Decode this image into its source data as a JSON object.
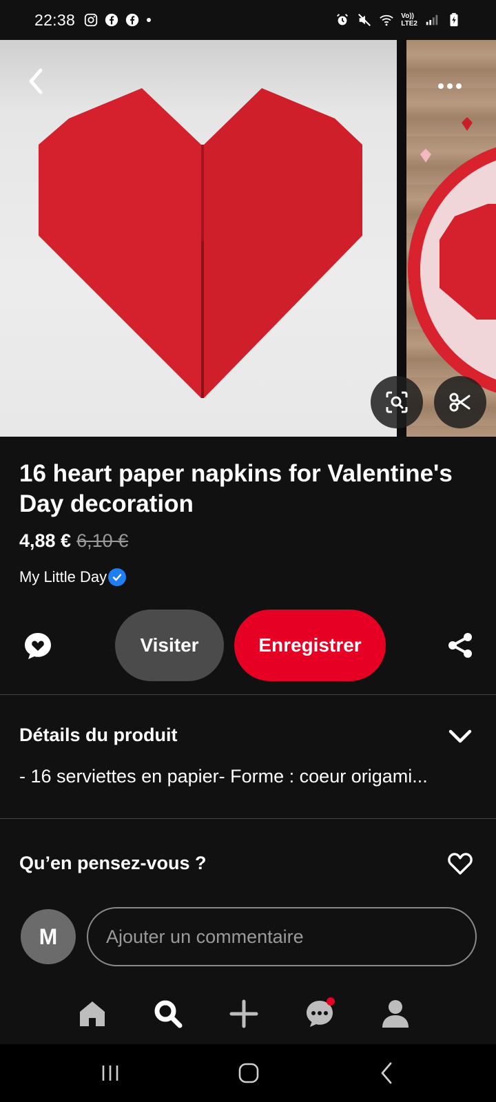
{
  "status_bar": {
    "time": "22:38",
    "left_icons": [
      "instagram-icon",
      "facebook-icon",
      "facebook-icon",
      "dot-icon"
    ],
    "right_icons": [
      "alarm-icon",
      "mute-icon",
      "wifi-icon",
      "volte-lte2-icon",
      "signal-icon",
      "battery-charging-icon"
    ],
    "network_label_top": "Vo))",
    "network_label_bottom": "LTE2"
  },
  "hero": {
    "back_icon": "chevron-left-icon",
    "more_icon": "more-horizontal-icon",
    "visual_search_icon": "visual-search-icon",
    "scissors_icon": "scissors-icon"
  },
  "product": {
    "title": "16 heart paper napkins for Valentine's Day decoration",
    "price": "4,88 €",
    "old_price": "6,10 €",
    "merchant": "My Little Day",
    "merchant_verified_icon": "verified-check-icon"
  },
  "actions": {
    "comment_icon": "comment-bubble-icon",
    "visit_label": "Visiter",
    "save_label": "Enregistrer",
    "share_icon": "share-icon"
  },
  "details": {
    "title": "Détails du produit",
    "text": "- 16 serviettes en papier- Forme : coeur origami...",
    "chevron_icon": "chevron-down-icon"
  },
  "feedback": {
    "title": "Qu’en pensez-vous ?",
    "heart_icon": "heart-outline-icon",
    "avatar_initial": "M",
    "comment_placeholder": "Ajouter un commentaire"
  },
  "bottom_nav": {
    "items": [
      "home-icon",
      "search-icon",
      "create-plus-icon",
      "messages-icon",
      "profile-icon"
    ],
    "active": "search-icon"
  },
  "system_nav": {
    "items": [
      "recent-apps-icon",
      "home-button-icon",
      "back-icon"
    ]
  },
  "colors": {
    "background": "#111111",
    "accent": "#e60023",
    "secondary_button": "#4b4b4b",
    "verified": "#1e7ef2"
  }
}
